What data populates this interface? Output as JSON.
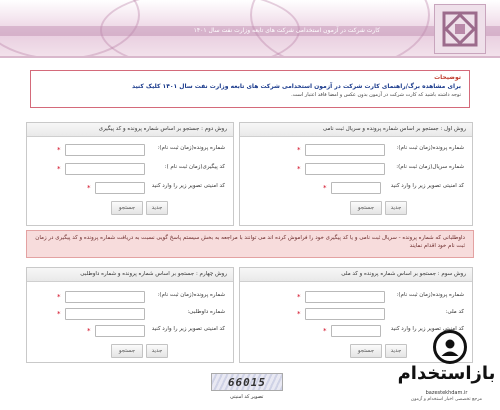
{
  "header": {
    "title": "کارت شرکت در آزمون استخدامی شرکت های تابعه وزارت نفت سال ۱۴۰۱"
  },
  "notice": {
    "title": "توضیحات",
    "line1": "برای مشاهده برگ/راهنمای کارت شرکت در آزمون استخدامی شرکت های تابعه وزارت نفت سال ۱۴۰۱ کلیک کنید",
    "line2": "توجه داشته باشید که کارت شرکت در آزمون بدون عکس و امضا فاقد اعتبار است."
  },
  "methods": {
    "m1": {
      "title": "روش اول : جستجو بر اساس شماره پرونده و سریال ثبت نامی",
      "field1": "شماره پرونده(زمان ثبت نام):",
      "field2": "شماره سریال(زمان ثبت نام):",
      "field3": "کد امنیتی تصویر زیر را وارد کنید",
      "search": "جستجو",
      "new": "جدید"
    },
    "m2": {
      "title": "روش دوم : جستجو بر اساس شماره پرونده و کد پیگیری",
      "field1": "شماره پرونده(زمان ثبت نام):",
      "field2": "کد پیگیری(زمان ثبت نام ):",
      "field3": "کد امنیتی تصویر زیر را وارد کنید",
      "search": "جستجو",
      "new": "جدید"
    },
    "m3": {
      "title": "روش سوم : جستجو بر اساس شماره پرونده و کد ملی",
      "field1": "شماره پرونده(زمان ثبت نام):",
      "field2": "کد ملی:",
      "field3": "کد امنیتی تصویر زیر را وارد کنید",
      "search": "جستجو",
      "new": "جدید"
    },
    "m4": {
      "title": "روش چهارم : جستجو بر اساس شماره پرونده و شماره داوطلبی",
      "field1": "شماره پرونده(زمان ثبت نام):",
      "field2": "شماره داوطلبی:",
      "field3": "کد امنیتی تصویر زیر را وارد کنید",
      "search": "جستجو",
      "new": "جدید"
    }
  },
  "alert": {
    "text": "داوطلبانی که شماره پرونده - سریال ثبت نامی و یا کد پیگیری خود را فراموش کرده اند می توانند با مراجعه به بخش سیستم پاسخ گویی نسبت به دریافت شماره پرونده و کد پیگیری در زمان ثبت نام خود اقدام نمایند"
  },
  "captcha": {
    "code": "66015",
    "label": "تصویر کد امنیتی"
  },
  "watermark": {
    "text": "بازاستخدام",
    "url": "bazestekhdam.ir",
    "subtitle": "مرجع تخصصی اخبار استخدام و آزمون"
  },
  "colors": {
    "accent": "#d46a7a",
    "alert_bg": "#f7dcdc",
    "required": "#d0021b"
  }
}
